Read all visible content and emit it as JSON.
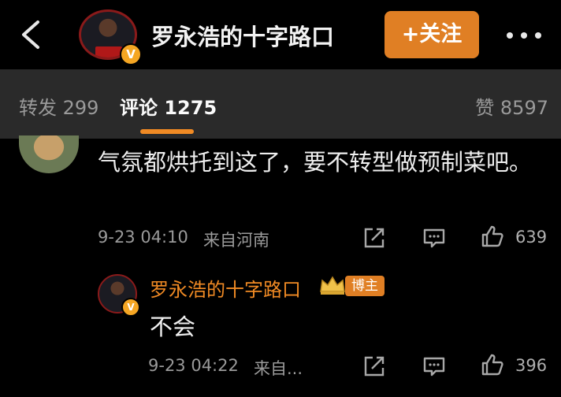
{
  "header": {
    "title": "罗永浩的十字路口",
    "follow_label": "+关注",
    "verified_mark": "V"
  },
  "tabs": {
    "repost": "转发 299",
    "comments": "评论 1275",
    "likes": "赞 8597"
  },
  "comments": [
    {
      "text": "气氛都烘托到这了，要不转型做预制菜吧。",
      "time": "9-23 04:10",
      "location": "来自河南",
      "likes": "639",
      "replies": [
        {
          "author": "罗永浩的十字路口",
          "badge": "博主",
          "text": "不会",
          "time": "9-23 04:22",
          "location": "来自...",
          "likes": "396"
        }
      ]
    }
  ],
  "colors": {
    "accent": "#e07f24",
    "tab_bar": "#2a2a2a",
    "background": "#000000"
  },
  "icons": [
    "back-icon",
    "more-icon",
    "share-icon",
    "reply-icon",
    "like-icon",
    "crown-icon"
  ]
}
